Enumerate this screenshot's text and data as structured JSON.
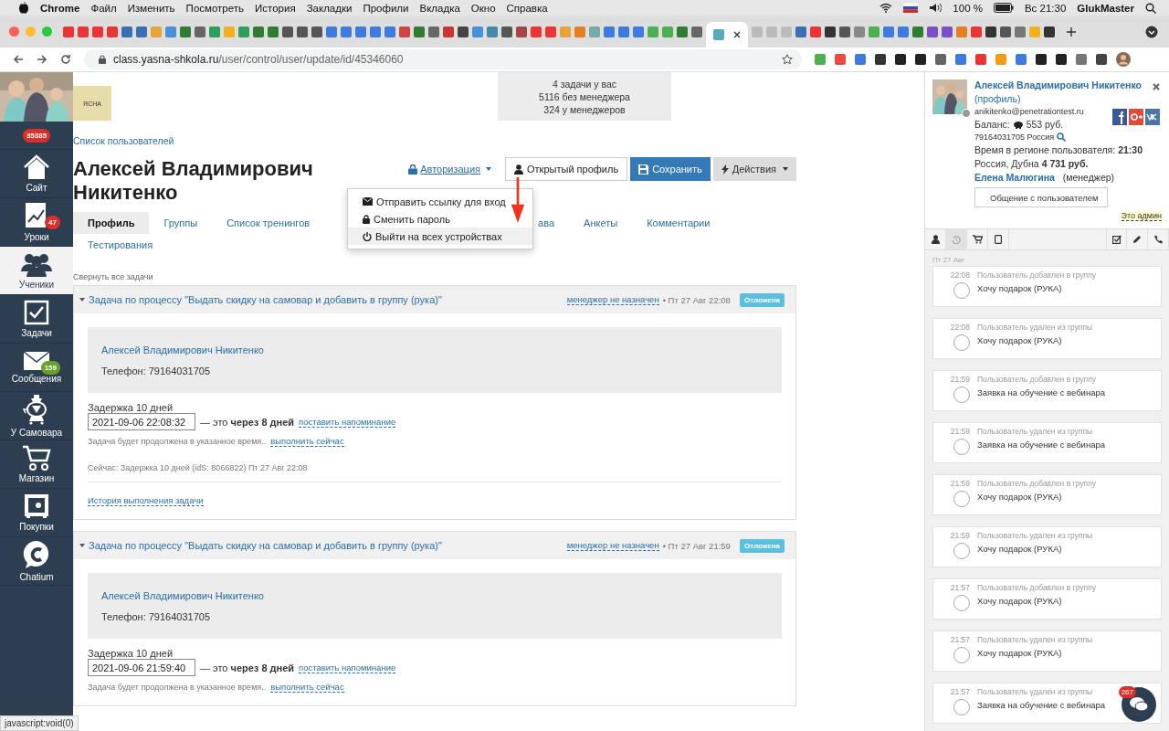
{
  "menu_bar": {
    "app": "Chrome",
    "items": [
      "Файл",
      "Изменить",
      "Посмотреть",
      "История",
      "Закладки",
      "Профили",
      "Вкладка",
      "Окно",
      "Справка"
    ],
    "battery": "100 %",
    "clock": "Вс 21:30",
    "user": "GlukMaster"
  },
  "browser": {
    "url_host": "class.yasna-shkola.ru",
    "url_path": "/user/control/user/update/id/45346060",
    "status_text": "javascript:void(0)"
  },
  "sidebar": {
    "counter": "35385",
    "items": [
      {
        "label": "Сайт",
        "selected": false
      },
      {
        "label": "Уроки",
        "badge": "47",
        "color": "#d9302c",
        "selected": false
      },
      {
        "label": "Ученики",
        "selected": true
      },
      {
        "label": "Задачи",
        "selected": false
      },
      {
        "label": "Сообщения",
        "badge": "159",
        "color": "#6aa02c",
        "selected": false
      },
      {
        "label": "У Самовара",
        "selected": false
      },
      {
        "label": "Магазин",
        "selected": false
      },
      {
        "label": "Покупки",
        "selected": false
      },
      {
        "label": "Chatium",
        "selected": false
      }
    ]
  },
  "header": {
    "logo_text": "ЯСНА",
    "stats": [
      "4 задачи у вас",
      "5116 без менеджера",
      "324 у менеджеров"
    ],
    "breadcrumb": "Список пользователей",
    "name": "Алексей Владимирович Никитенко",
    "auth_link": "Авторизация",
    "buttons": [
      {
        "label": "Открытый профиль",
        "kind": "default"
      },
      {
        "label": "Сохранить",
        "kind": "primary"
      },
      {
        "label": "Действия",
        "kind": "gray"
      }
    ]
  },
  "dropdown": {
    "items": [
      {
        "label": "Отправить ссылку для вход",
        "selected": false
      },
      {
        "label": "Сменить пароль",
        "selected": false
      },
      {
        "label": "Выйти на всех устройствах",
        "selected": true
      }
    ]
  },
  "tabs": [
    {
      "label": "Профиль",
      "selected": true
    },
    {
      "label": "Группы",
      "selected": false
    },
    {
      "label": "Список тренингов",
      "selected": false
    },
    {
      "label": "ава",
      "selected": false
    },
    {
      "label": "Анкеты",
      "selected": false
    },
    {
      "label": "Комментарии",
      "selected": false
    },
    {
      "label": "Тестирования",
      "selected": false
    }
  ],
  "tasks": {
    "collapse_all": "Свернуть все задачи",
    "items": [
      {
        "title": "Задача по процессу \"Выдать скидку на самовар и добавить в группу (рука)\"",
        "manager": "менеджер не назначен",
        "date": "• Пт 27 Авг 22:08",
        "status": "Отложена",
        "contact_name": "Алексей Владимирович Никитенко",
        "phone": "Телефон: 79164031705",
        "delay": "Задержка 10 дней",
        "datetime": "2021-09-06 22:08:32",
        "relative": "— это **через 8 дней**",
        "reminder": "поставить напоминание",
        "note": "Задача будет продолжена в указанное время..",
        "run_now": "выполнить сейчас",
        "current": "Сейчас: Задержка 10 дней (idS: 8066822) Пт 27 Авг 22:08",
        "history": "История выполнения задачи"
      },
      {
        "title": "Задача по процессу \"Выдать скидку на самовар и добавить в группу (рука)\"",
        "manager": "менеджер не назначен",
        "date": "• Пт 27 Авг 21:59",
        "status": "Отложена",
        "contact_name": "Алексей Владимирович Никитенко",
        "phone": "Телефон: 79164031705",
        "delay": "Задержка 10 дней",
        "datetime": "2021-09-06 21:59:40",
        "relative": "— это **через 8 дней**",
        "reminder": "поставить напоминание",
        "note": "Задача будет продолжена в указанное время..",
        "run_now": "выполнить сейчас"
      }
    ]
  },
  "user_panel": {
    "name": "Алексей Владимирович Никитенко",
    "profile_link": "(профиль)",
    "email": "anikitenko@penetrationtest.ru",
    "balance": "Баланс:",
    "balance_value": "553 руб.",
    "phone": "79164031705 Россия",
    "local_time": "Время в регионе пользователя: **21:30**",
    "location": "Россия, Дубна **4 731 руб.**",
    "manager_name": "Елена Малюгина",
    "manager_role": "(менеджер)",
    "chat_button": "Общение с пользователем",
    "admin_note": "Это админ",
    "tabs": [
      {
        "selected": false
      },
      {
        "selected": true
      },
      {
        "selected": false
      },
      {
        "selected": false
      },
      {
        "selected": false
      },
      {
        "selected": false
      },
      {
        "selected": false
      }
    ]
  },
  "feed": {
    "date": "Пт 27 Авг",
    "items": [
      {
        "time": "22:08",
        "event": "Пользователь добавлен в группу",
        "title": "Хочу подарок (РУКА)"
      },
      {
        "time": "22:08",
        "event": "Пользователь удален из группы",
        "title": "Хочу подарок (РУКА)"
      },
      {
        "time": "21:59",
        "event": "Пользователь добавлен в группу",
        "title": "Заявка на обучение с вебинара"
      },
      {
        "time": "21:59",
        "event": "Пользователь удален из группы",
        "title": "Заявка на обучение с вебинара"
      },
      {
        "time": "21:59",
        "event": "Пользователь добавлен в группу",
        "title": "Хочу подарок (РУКА)"
      },
      {
        "time": "21:59",
        "event": "Пользователь удален из группы",
        "title": "Хочу подарок (РУКА)"
      },
      {
        "time": "21:57",
        "event": "Пользователь добавлен в группу",
        "title": "Хочу подарок (РУКА)"
      },
      {
        "time": "21:57",
        "event": "Пользователь удален из группы",
        "title": "Хочу подарок (РУКА)"
      },
      {
        "time": "21:57",
        "event": "Пользователь удален из группы",
        "title": "Заявка на обучение с вебинара"
      }
    ]
  },
  "chat_widget": {
    "badge": "267"
  }
}
